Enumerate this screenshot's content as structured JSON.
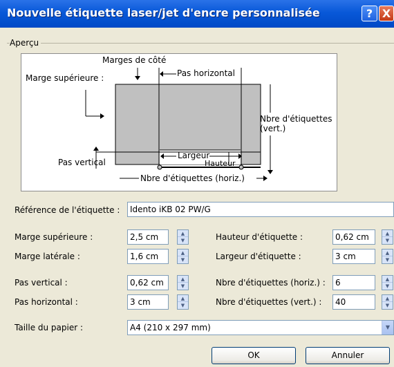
{
  "window": {
    "title": "Nouvelle étiquette laser/jet d'encre personnalisée",
    "help_label": "?",
    "close_label": "X"
  },
  "preview": {
    "group_label": "Aperçu",
    "marges_cote": "Marges de côté",
    "pas_horizontal": "Pas horizontal",
    "marge_superieure": "Marge supérieure :",
    "nbre_vert_line1": "Nbre d'étiquettes",
    "nbre_vert_line2": "(vert.)",
    "largeur": "Largeur",
    "hauteur": "Hauteur",
    "pas_vertical": "Pas vertical",
    "nbre_horiz": "Nbre d'étiquettes (horiz.)"
  },
  "form": {
    "reference": {
      "label": "Référence de l'étiquette :",
      "value": "Idento iKB 02 PW/G"
    },
    "marge_superieure": {
      "label": "Marge supérieure :",
      "value": "2,5 cm"
    },
    "marge_laterale": {
      "label": "Marge latérale :",
      "value": "1,6 cm"
    },
    "pas_vertical": {
      "label": "Pas vertical :",
      "value": "0,62 cm"
    },
    "pas_horizontal": {
      "label": "Pas horizontal :",
      "value": "3 cm"
    },
    "hauteur_etiquette": {
      "label": "Hauteur d'étiquette :",
      "value": "0,62 cm"
    },
    "largeur_etiquette": {
      "label": "Largeur d'étiquette :",
      "value": "3 cm"
    },
    "nbre_horiz": {
      "label": "Nbre d'étiquettes (horiz.) :",
      "value": "6"
    },
    "nbre_vert": {
      "label": "Nbre d'étiquettes (vert.) :",
      "value": "40"
    },
    "taille_papier": {
      "label": "Taille du papier :",
      "value": "A4 (210 x 297 mm)"
    }
  },
  "buttons": {
    "ok": "OK",
    "annuler": "Annuler"
  }
}
